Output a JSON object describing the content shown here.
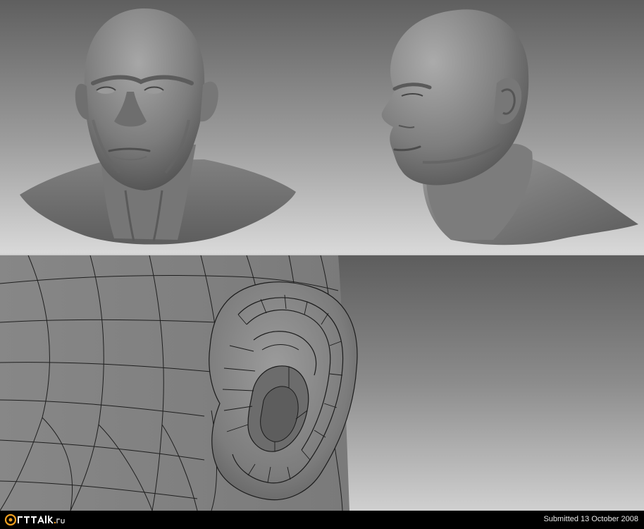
{
  "footer": {
    "submitted": "Submitted 13 October 2008",
    "logo_text": "arttalk.ru"
  },
  "colors": {
    "background_top": "#e6e6e6",
    "background_bottom": "#a6a6a6",
    "clay": "#8a8a8a",
    "wireframe": "#1e1e1e",
    "logo_accent": "#f0a020"
  },
  "icons": {
    "logo": "arttalk-logo"
  }
}
